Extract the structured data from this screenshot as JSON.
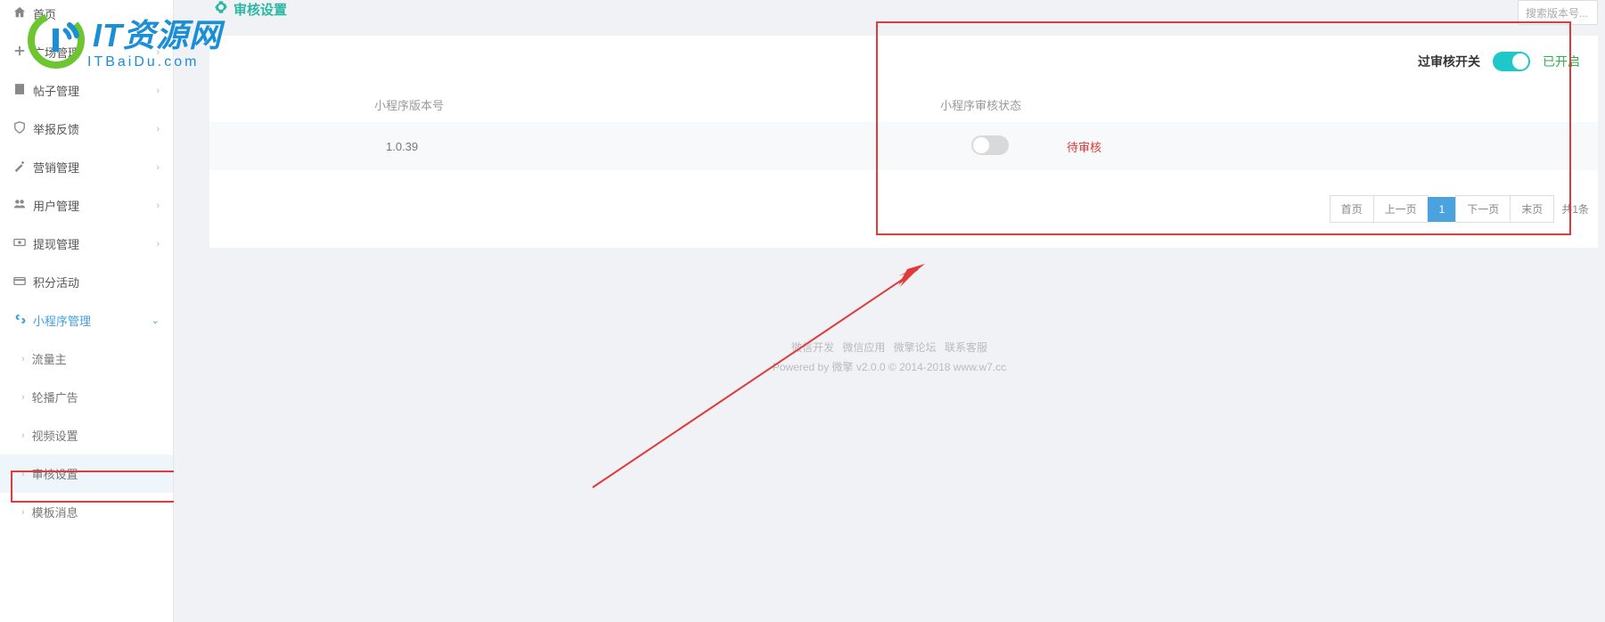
{
  "logo": {
    "main": "IT资源网",
    "sub": "ITBaiDu.com"
  },
  "sidebar": {
    "items": [
      {
        "icon": "home",
        "label": "首页"
      },
      {
        "icon": "square",
        "label": "广场管理"
      },
      {
        "icon": "post",
        "label": "帖子管理"
      },
      {
        "icon": "shield",
        "label": "举报反馈"
      },
      {
        "icon": "magic",
        "label": "营销管理"
      },
      {
        "icon": "users",
        "label": "用户管理"
      },
      {
        "icon": "cash",
        "label": "提现管理"
      },
      {
        "icon": "credit",
        "label": "积分活动"
      },
      {
        "icon": "miniapp",
        "label": "小程序管理"
      }
    ],
    "subitems": [
      {
        "label": "流量主"
      },
      {
        "label": "轮播广告"
      },
      {
        "label": "视频设置"
      },
      {
        "label": "审核设置"
      },
      {
        "label": "模板消息"
      }
    ]
  },
  "page": {
    "title": "审核设置",
    "search_placeholder": "搜索版本号...",
    "switch_label": "过审核开关",
    "switch_status": "已开启",
    "table": {
      "header_version": "小程序版本号",
      "header_status": "小程序审核状态",
      "rows": [
        {
          "version": "1.0.39",
          "status": "待审核",
          "on": false
        }
      ]
    },
    "pager": {
      "first": "首页",
      "prev": "上一页",
      "current": "1",
      "next": "下一页",
      "last": "末页",
      "total": "共1条"
    }
  },
  "footer": {
    "line1_a": "微信开发",
    "line1_b": "微信应用",
    "line1_c": "微擎论坛",
    "line1_d": "联系客服",
    "line2": "Powered by 微擎 v2.0.0 © 2014-2018 www.w7.cc"
  }
}
